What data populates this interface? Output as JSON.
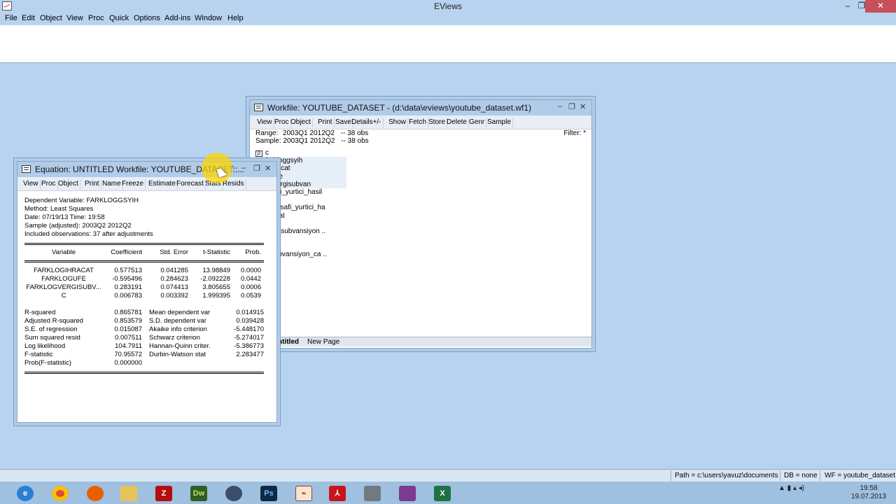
{
  "app": {
    "title": "EViews"
  },
  "window_controls": {
    "minimize": "–",
    "restore": "❐",
    "close": "✕"
  },
  "menu": [
    "File",
    "Edit",
    "Object",
    "View",
    "Proc",
    "Quick",
    "Options",
    "Add-ins",
    "Window",
    "Help"
  ],
  "workfile": {
    "title": "Workfile: YOUTUBE_DATASET - (d:\\data\\eviews\\youtube_dataset.wf1)",
    "toolbar": [
      "View",
      "Proc",
      "Object",
      "Print",
      "Save",
      "Details+/-",
      "Show",
      "Fetch",
      "Store",
      "Delete",
      "Genr",
      "Sample"
    ],
    "range_label": "Range:",
    "range_value": "2003Q1 2012Q2",
    "range_obs": "--  38 obs",
    "sample_label": "Sample:",
    "sample_value": "2003Q1 2012Q2",
    "sample_obs": "--  38 obs",
    "filter": "Filter: *",
    "objects": [
      "c",
      "farkloggsyih",
      "gihracat",
      "ogufe",
      "ogvergisubvan",
      "i_safi_yurtici_hasil",
      "cat",
      "ayri_safi_yurtici_ha",
      "hracat",
      "fe",
      "ergi_subvansiyon ..",
      "d",
      "",
      "i_subvansiyon_ca .."
    ],
    "tabs": [
      "ntitled",
      "New Page"
    ]
  },
  "equation": {
    "title": "Equation: UNTITLED   Workfile: YOUTUBE_DATASET::...",
    "toolbar": [
      "View",
      "Proc",
      "Object",
      "Print",
      "Name",
      "Freeze",
      "Estimate",
      "Forecast",
      "Stats",
      "Resids"
    ],
    "header": [
      "Dependent Variable: FARKLOGGSYIH",
      "Method: Least Squares",
      "Date: 07/19/13   Time: 19:58",
      "Sample (adjusted): 2003Q2 2012Q2",
      "Included observations: 37 after adjustments"
    ],
    "columns": [
      "Variable",
      "Coefficient",
      "Std. Error",
      "t-Statistic",
      "Prob."
    ],
    "rows": [
      [
        "FARKLOGIHRACAT",
        "0.577513",
        "0.041285",
        "13.98849",
        "0.0000"
      ],
      [
        "FARKLOGUFE",
        "-0.595496",
        "0.284623",
        "-2.092228",
        "0.0442"
      ],
      [
        "FARKLOGVERGISUBV...",
        "0.283191",
        "0.074413",
        "3.805655",
        "0.0006"
      ],
      [
        "C",
        "0.006783",
        "0.003392",
        "1.999395",
        "0.0539"
      ]
    ],
    "stats": [
      [
        "R-squared",
        "0.865781",
        "Mean dependent var",
        "0.014915"
      ],
      [
        "Adjusted R-squared",
        "0.853579",
        "S.D. dependent var",
        "0.039428"
      ],
      [
        "S.E. of regression",
        "0.015087",
        "Akaike info criterion",
        "-5.448170"
      ],
      [
        "Sum squared resid",
        "0.007511",
        "Schwarz criterion",
        "-5.274017"
      ],
      [
        "Log likelihood",
        "104.7911",
        "Hannan-Quinn criter.",
        "-5.386773"
      ],
      [
        "F-statistic",
        "70.95572",
        "Durbin-Watson stat",
        "2.283477"
      ],
      [
        "Prob(F-statistic)",
        "0.000000",
        "",
        ""
      ]
    ]
  },
  "status": {
    "path": "Path = c:\\users\\yavuz\\documents",
    "db": "DB = none",
    "wf": "WF = youtube_dataset"
  },
  "taskbar": {
    "apps": [
      "internet-explorer",
      "chrome",
      "firefox",
      "file-explorer",
      "filezilla",
      "dreamweaver",
      "media-player",
      "photoshop",
      "eviews",
      "acrobat",
      "tool",
      "winrar",
      "excel"
    ],
    "tray": "▲  ▮  ▴  ◂)",
    "time": "19:58",
    "date": "19.07.2013"
  }
}
